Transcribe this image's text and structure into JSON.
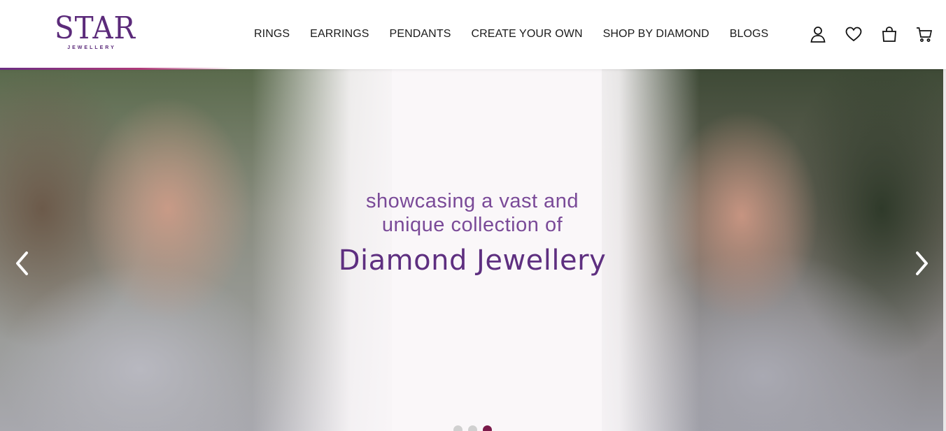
{
  "brand": {
    "logo_word": "STAR",
    "logo_sub": "JEWELLERY",
    "accent_color": "#5b2a7a"
  },
  "nav": {
    "items": [
      {
        "label": "RINGS"
      },
      {
        "label": "EARRINGS"
      },
      {
        "label": "PENDANTS"
      },
      {
        "label": "CREATE YOUR OWN"
      },
      {
        "label": "SHOP BY DIAMOND"
      },
      {
        "label": "BLOGS"
      }
    ]
  },
  "header_icons": [
    {
      "icon": "user-icon"
    },
    {
      "icon": "heart-icon"
    },
    {
      "icon": "shopping-bag-icon"
    },
    {
      "icon": "cart-icon"
    }
  ],
  "hero": {
    "line1": "showcasing a vast and",
    "line2": "unique collection of",
    "title": "Diamond Jewellery",
    "slide_count": 3,
    "active_slide": 3,
    "dot_active_color": "#7a1a4a"
  }
}
